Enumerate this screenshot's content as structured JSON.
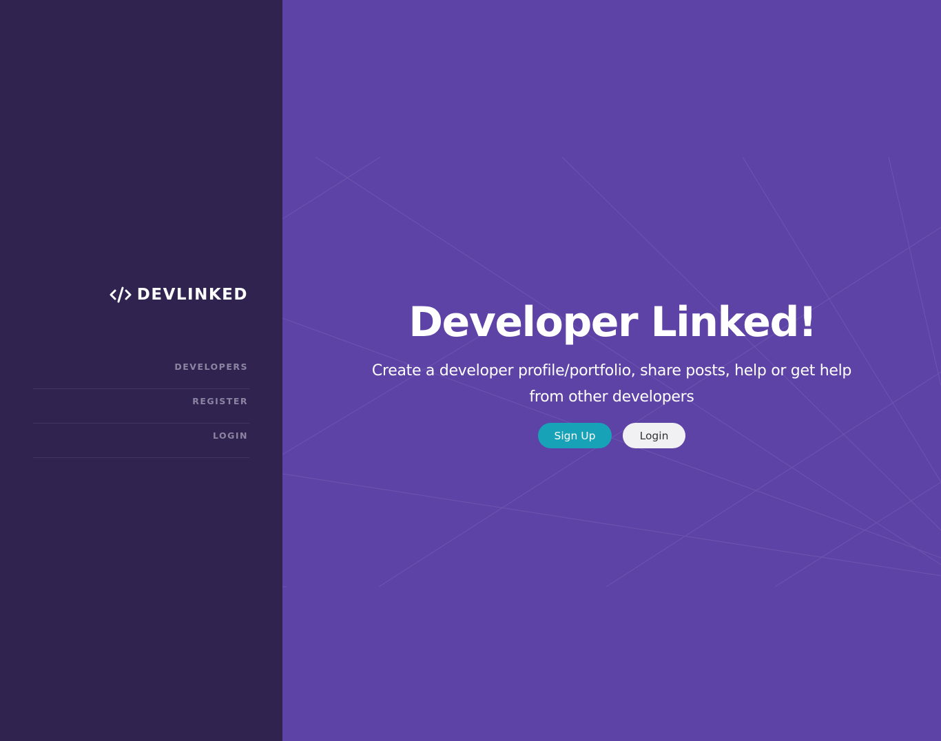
{
  "brand": {
    "name": "DEVLINKED",
    "icon": "code-icon"
  },
  "nav": {
    "items": [
      {
        "label": "DEVELOPERS"
      },
      {
        "label": "REGISTER"
      },
      {
        "label": "LOGIN"
      }
    ]
  },
  "hero": {
    "title": "Developer Linked!",
    "subtitle": "Create a developer profile/portfolio, share posts, help or get help from other developers",
    "signup_label": "Sign Up",
    "login_label": "Login"
  },
  "colors": {
    "sidebar_bg": "#31234f",
    "main_bg": "#5e43a6",
    "signup_accent": "#17a2b8",
    "nav_text": "#8c84a3"
  }
}
